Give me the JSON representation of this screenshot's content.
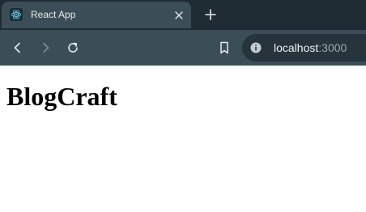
{
  "browser": {
    "tab": {
      "title": "React App",
      "favicon": "react-logo-icon"
    },
    "url": {
      "host": "localhost",
      "port": ":3000"
    },
    "colors": {
      "tabstrip": "#202c33",
      "toolbar": "#3b4d57",
      "omnibox": "#27343b"
    }
  },
  "page": {
    "heading": "BlogCraft"
  }
}
